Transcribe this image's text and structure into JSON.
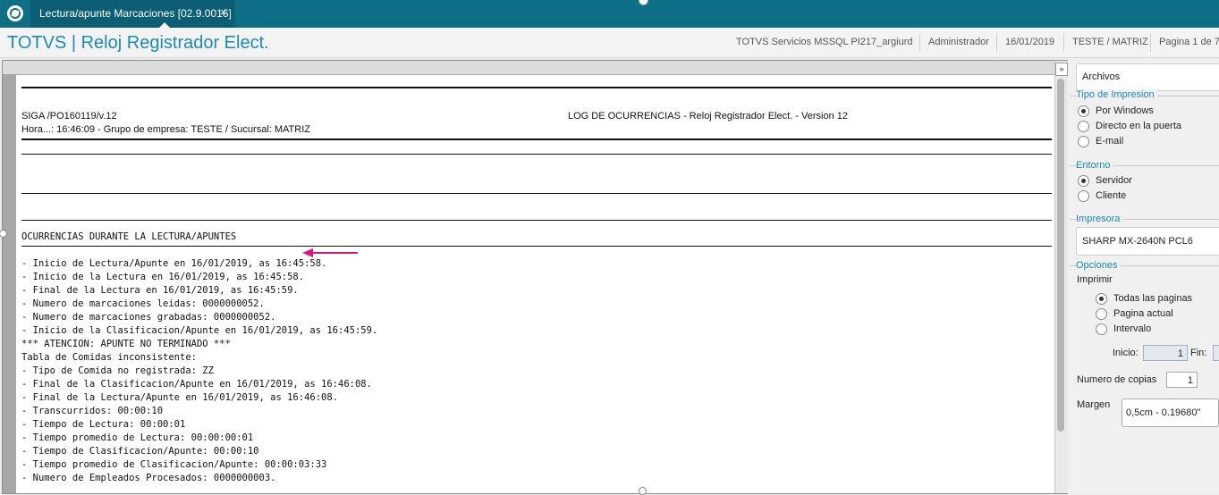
{
  "tab": {
    "title": "Lectura/apunte Marcaciones [02.9.0016]",
    "close": "×"
  },
  "header": {
    "app_title": "TOTVS | Reloj Registrador Elect.",
    "environment": "TOTVS Servicios MSSQL PI217_argiurd",
    "user": "Administrador",
    "date": "16/01/2019",
    "company": "TESTE / MATRIZ",
    "page": "Pagina 1 de 7"
  },
  "viewer": {
    "expand_icon": "»"
  },
  "report": {
    "program": "SIGA /PO160119/v.12",
    "log_title": "LOG DE OCURRENCIAS - Reloj Registrador Elect. - Version 12",
    "time_line": "Hora...: 16:46:09 - Grupo de empresa: TESTE / Sucursal: MATRIZ",
    "section_title": "OCURRENCIAS DURANTE LA LECTURA/APUNTES",
    "lines": [
      "- Inicio de Lectura/Apunte en 16/01/2019, as 16:45:58.",
      "- Inicio de la Lectura en 16/01/2019, as 16:45:58.",
      "- Final de la Lectura en 16/01/2019, as 16:45:59.",
      "- Numero de marcaciones leidas: 0000000052.",
      "- Numero de marcaciones grabadas: 0000000052.",
      "- Inicio de la Clasificacion/Apunte en 16/01/2019, as 16:45:59.",
      "*** ATENCION: APUNTE NO TERMINADO ***",
      "Tabla de Comidas inconsistente:",
      "- Tipo de Comida no registrada: ZZ",
      "- Final de la Clasificacion/Apunte en 16/01/2019, as 16:46:08.",
      "- Final de la Lectura/Apunte en 16/01/2019, as 16:46:08.",
      "- Transcurridos: 00:00:10",
      "- Tiempo de Lectura: 00:00:01",
      "- Tiempo promedio de Lectura: 00:00:00:01",
      "- Tiempo de Clasificacion/Apunte: 00:00:10",
      "- Tiempo promedio de Clasificacion/Apunte: 00:00:03:33",
      "- Numero de Empleados Procesados: 0000000003."
    ]
  },
  "annotation": {
    "arrow_color": "#e0157a"
  },
  "panel": {
    "archivos": "Archivos",
    "tipo_impresion": {
      "legend": "Tipo de Impresion",
      "options": [
        "Por Windows",
        "Directo en la puerta",
        "E-mail"
      ],
      "selected": "Por Windows"
    },
    "entorno": {
      "legend": "Entorno",
      "options": [
        "Servidor",
        "Cliente"
      ],
      "selected": "Servidor"
    },
    "impresora": {
      "legend": "Impresora",
      "value": "SHARP MX-2640N PCL6"
    },
    "opciones": {
      "legend": "Opciones",
      "imprimir_label": "Imprimir",
      "options": [
        "Todas las paginas",
        "Pagina actual",
        "Intervalo"
      ],
      "selected": "Todas las paginas",
      "inicio_label": "Inicio:",
      "inicio_value": "1",
      "fin_label": "Fin:",
      "fin_value": ""
    },
    "copias": {
      "label": "Numero de copias",
      "value": "1"
    },
    "margen": {
      "label": "Margen",
      "value": "0,5cm - 0.19680\""
    }
  },
  "colors": {
    "brand": "#0e6f86",
    "accent": "#1b8bb5",
    "annotation": "#e0157a"
  }
}
